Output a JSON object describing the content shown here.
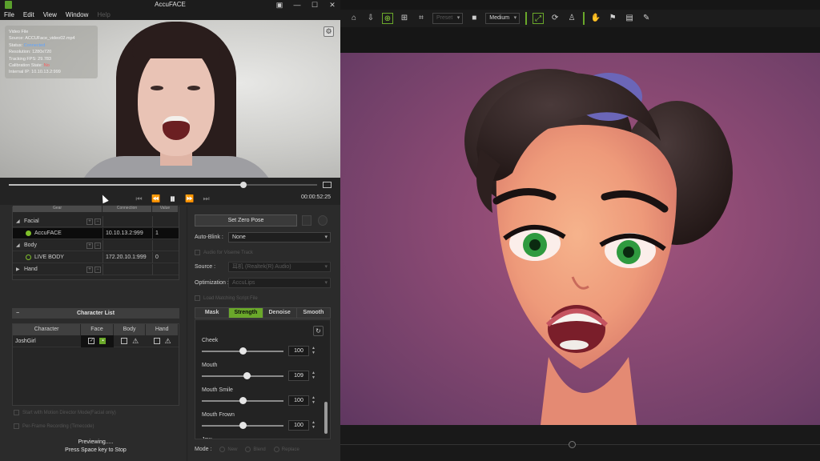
{
  "app": {
    "title": "AccuFACE",
    "menu": [
      "File",
      "Edit",
      "View",
      "Window",
      "Help"
    ],
    "window_controls": [
      "▣",
      "—",
      "☐",
      "✕"
    ]
  },
  "video_info": {
    "lines": [
      {
        "label": "Video File",
        "value": ""
      },
      {
        "label": "Source:",
        "value": "ACCUFace_video02.mp4"
      },
      {
        "label": "Status:",
        "value": "Connected"
      },
      {
        "label": "Resolution:",
        "value": "1280x720"
      },
      {
        "label": "Tracking FPS:",
        "value": "29.783"
      },
      {
        "label": "Calibration State:",
        "value": "No"
      },
      {
        "label": "Internal IP:",
        "value": "10.10.13.2:999"
      }
    ]
  },
  "transport": {
    "progress": 0.76,
    "timecode": "00:00:52:25",
    "buttons": [
      "⏮",
      "⏪",
      "⏸",
      "⏩",
      "⏭"
    ]
  },
  "device_tree": {
    "headers": [
      "Gear",
      "Connection",
      "Value"
    ],
    "rows": [
      {
        "type": "group",
        "name": "Facial",
        "ip": "",
        "val": ""
      },
      {
        "type": "device",
        "name": "AccuFACE",
        "ip": "10.10.13.2:999",
        "val": "1",
        "status": "on",
        "selected": true
      },
      {
        "type": "group",
        "name": "Body",
        "ip": "",
        "val": ""
      },
      {
        "type": "device",
        "name": "LIVE BODY",
        "ip": "172.20.10.1:999",
        "val": "0",
        "status": "off",
        "selected": false
      },
      {
        "type": "group-collapsed",
        "name": "Hand",
        "ip": "",
        "val": ""
      }
    ]
  },
  "character_list": {
    "title": "Character List",
    "headers": [
      "Character",
      "Face",
      "Body",
      "Hand"
    ],
    "rows": [
      {
        "name": "JoshGirl"
      }
    ]
  },
  "options": {
    "motion_director": "Start with Motion Director Mode(Facial only)",
    "per_frame": "Per-Frame Recording (Timecode)"
  },
  "status": {
    "line1": "Previewing.....",
    "line2": "Press Space key to Stop"
  },
  "middle": {
    "zero_pose": "Set Zero Pose",
    "auto_blink_label": "Auto-Blink :",
    "auto_blink_value": "None",
    "audio_lip": "Audio for Viseme Track",
    "source_label": "Source :",
    "source_value": "耳机 (Realtek(R) Audio)",
    "optimization_label": "Optimization :",
    "optimization_value": "AccuLips",
    "load_script": "Load Matching Script File",
    "tabs": [
      "Mask",
      "Strength",
      "Denoise",
      "Smooth"
    ],
    "active_tab": 1,
    "sliders": [
      {
        "label": "Cheek",
        "value": "100",
        "pos": 0.5
      },
      {
        "label": "Mouth",
        "value": "109",
        "pos": 0.55
      },
      {
        "label": "Mouth Smile",
        "value": "100",
        "pos": 0.5
      },
      {
        "label": "Mouth Frown",
        "value": "100",
        "pos": 0.5
      },
      {
        "label": "Jaw",
        "value": "",
        "pos": 0.5
      }
    ],
    "mode_label": "Mode :",
    "modes": [
      "New",
      "Blend",
      "Replace"
    ]
  },
  "viewport_toolbar": {
    "preset": "Preset",
    "quality": "Medium"
  },
  "colors": {
    "accent": "#6aa82a",
    "viewport_bg": "#8c4a74"
  }
}
